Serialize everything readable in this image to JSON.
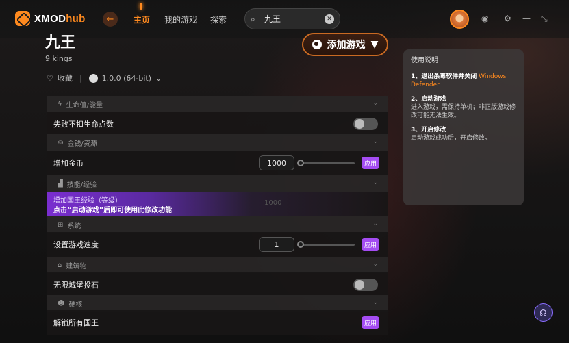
{
  "app": {
    "logo_x": "XMOD",
    "logo_hub": "hub"
  },
  "nav": {
    "home": "主页",
    "my_games": "我的游戏",
    "explore": "探索"
  },
  "search": {
    "value": "九王"
  },
  "game": {
    "title": "九王",
    "subtitle": "9 kings",
    "favorite": "收藏",
    "version": "1.0.0 (64-bit)",
    "add_button": "添加游戏"
  },
  "sections": [
    {
      "label": "生命值/能量"
    },
    {
      "label": "金钱/资源"
    },
    {
      "label": "技能/经验"
    },
    {
      "label": "系统"
    },
    {
      "label": "建筑物"
    },
    {
      "label": "硬核"
    }
  ],
  "cheats": {
    "no_hp_loss": "失败不扣生命点数",
    "add_gold": "增加金币",
    "add_gold_value": "1000",
    "add_exp": "增加国王经验（等级）",
    "locked_hint": "点击“启动游戏”后即可使用此修改功能",
    "add_exp_value": "1000",
    "game_speed": "设置游戏速度",
    "game_speed_value": "1",
    "infinite_castle": "无限城堡投石",
    "unlock_kings": "解锁所有国王",
    "apply": "应用"
  },
  "instructions": {
    "title": "使用说明",
    "step1_title": "1、退出杀毒软件并关闭",
    "step1_warn": "Windows Defender",
    "step2_title": "2、启动游戏",
    "step2_text": "进入游戏，需保持单机；非正版游戏修改可能无法生效。",
    "step3_title": "3、开启修改",
    "step3_text": "启动游戏成功后，开启修改。"
  },
  "colors": {
    "accent": "#ff8a1f",
    "apply": "#a44cf2"
  }
}
